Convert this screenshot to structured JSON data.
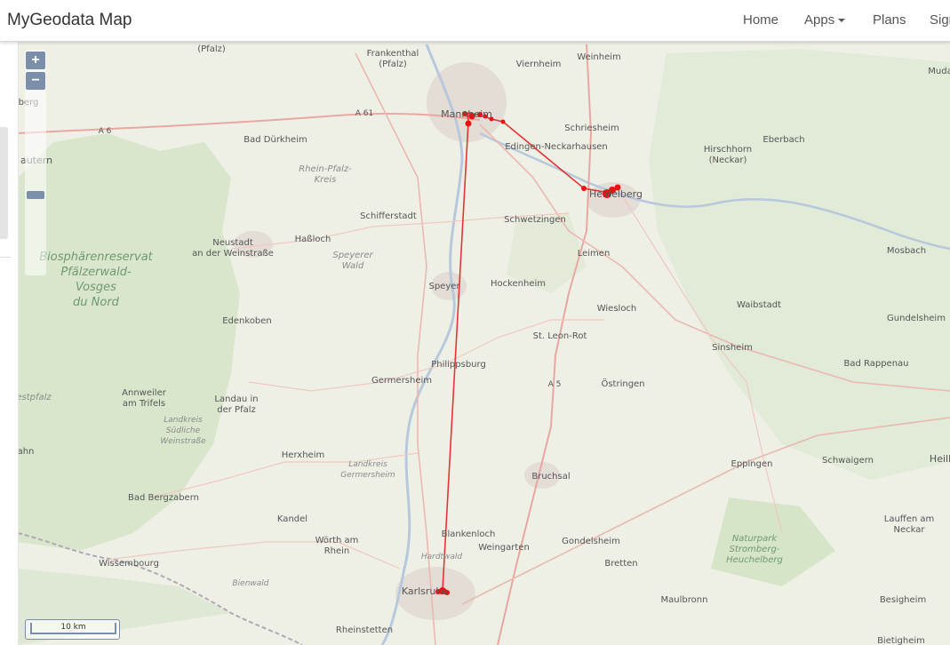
{
  "navbar": {
    "brand": "MyGeodata Map",
    "items": [
      {
        "label": "Home"
      },
      {
        "label": "Apps"
      },
      {
        "label": "Plans"
      },
      {
        "label": "Sign"
      }
    ]
  },
  "map": {
    "zoom_in": "+",
    "zoom_out": "−",
    "scale_label": "10 km",
    "track_color": "#e02020",
    "labels": [
      "Frankenthal\n(Pfalz)",
      "(Pfalz)",
      "Viernheim",
      "Weinheim",
      "Muda",
      "berg",
      "A 61",
      "A 6",
      "Mannheim",
      "Schriesheim",
      "Bad Dürkheim",
      "Edingen-Neckarhausen",
      "Hirschhorn\n(Neckar)",
      "Eberbach",
      "Rhein-Pfalz-\nKreis",
      "Heidelberg",
      "autern",
      "Schifferstadt",
      "Schwetzingen",
      "Neustadt\nan der Weinstraße",
      "Haßloch",
      "Speyerer\nWald",
      "Leimen",
      "Mosbach",
      "Biosphärenreservat\nPfälzerwald-\nVosges\ndu Nord",
      "Speyer",
      "Hockenheim",
      "Wiesloch",
      "Waibstadt",
      "Gundelsheim",
      "Edenkoben",
      "St. Leon-Rot",
      "Sinsheim",
      "Philippsburg",
      "Bad Rappenau",
      "A 5",
      "Germersheim",
      "Östringen",
      "Annweiler\nam Trifels",
      "Landau in\nder Pfalz",
      "estpfalz",
      "Landkreis\nSüdliche\nWeinstraße",
      "Herxheim",
      "Landkreis\nGermersheim",
      "Bruchsal",
      "Eppingen",
      "Schwaigern",
      "Heilb",
      "ahn",
      "Bad Bergzabern",
      "Kandel",
      "Lauffen am\nNeckar",
      "Wörth am\nRhein",
      "Blankenloch",
      "Naturpark\nStromberg-\nHeuchelberg",
      "Weingarten",
      "Gondelsheim",
      "Wissembourg",
      "Hardtwald",
      "Bretten",
      "Bienwald",
      "Karlsruhe",
      "Maulbronn",
      "Besigheim",
      "Rheinstetten",
      "Bietigheim"
    ]
  }
}
